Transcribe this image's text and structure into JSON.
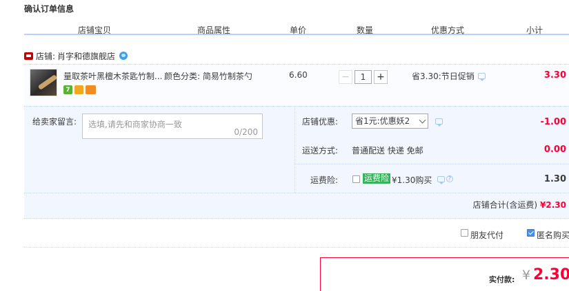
{
  "page_title": "确认订单信息",
  "columns": [
    "店铺宝贝",
    "商品属性",
    "单价",
    "数量",
    "优惠方式",
    "小计"
  ],
  "shop": {
    "label": "店铺:",
    "name": "肖字和德旗舰店"
  },
  "item": {
    "title": "量取茶叶黑檀木茶匙竹制...",
    "attribute": "颜色分类: 简易竹制茶勺",
    "price": "6.60",
    "quantity": "1",
    "promotion": "省3.30:节日促销",
    "subtotal": "3.30",
    "badges": [
      "7",
      "shield-icon",
      "card-icon"
    ]
  },
  "message": {
    "label": "给卖家留言:",
    "placeholder": "选填,请先和商家协商一致",
    "counter": "0/200"
  },
  "shop_coupon": {
    "label": "店铺优惠:",
    "selected": "省1元:优惠妖2",
    "amount": "-1.00"
  },
  "shipping": {
    "label": "运送方式:",
    "value": "普通配送 快递 免邮",
    "amount": "0.00"
  },
  "insurance": {
    "label": "运费险:",
    "tag": "运费险",
    "text": "¥1.30购买",
    "help": "?",
    "amount": "1.30",
    "checked": false
  },
  "shop_total": {
    "label": "店铺合计(含运费)",
    "amount": "¥2.30"
  },
  "extra": {
    "friend_pay": "朋友代付",
    "anonymous": "匿名购买",
    "friend_pay_checked": false,
    "anonymous_checked": true
  },
  "payment": {
    "label": "实付款:",
    "currency": "¥",
    "amount": "2.30"
  },
  "colors": {
    "accent_red": "#ff0036",
    "header_border": "#b2d1ff",
    "detail_bg": "#f2f7ff",
    "insurance_green": "#35b25a"
  }
}
